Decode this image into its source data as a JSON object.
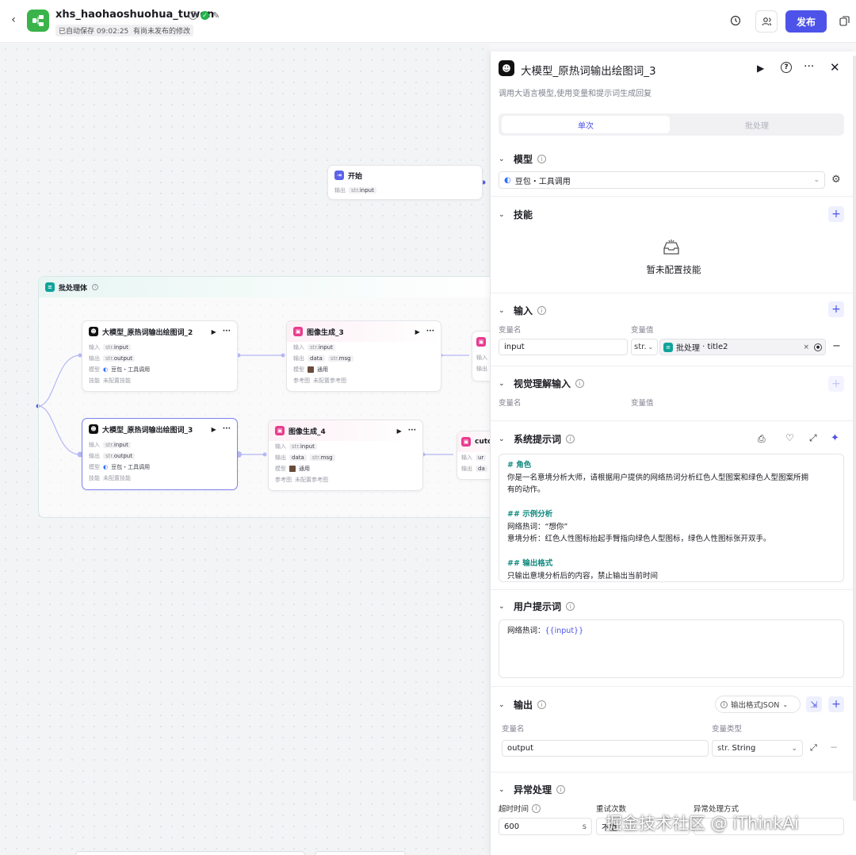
{
  "header": {
    "project_name": "xhs_haohaoshuohua_tuwen",
    "autosave": "已自动保存 09:02:25",
    "unpublished": "有尚未发布的修改",
    "publish_label": "发布"
  },
  "canvas": {
    "start_node": {
      "title": "开始",
      "row_label": "输出",
      "row_type": "str.",
      "row_value": "input"
    },
    "batch_group": {
      "title": "批处理体"
    },
    "nodes": {
      "llm2": {
        "title": "大模型_原热词输出绘图词_2",
        "rows": [
          {
            "label": "输入",
            "type": "str.",
            "value": "input"
          },
          {
            "label": "输出",
            "type": "str.",
            "value": "output"
          },
          {
            "label": "模型",
            "type": "",
            "value": "豆包・工具调用"
          },
          {
            "label": "技能",
            "type": "",
            "value": "未配置技能"
          }
        ]
      },
      "img3": {
        "title": "图像生成_3",
        "rows": [
          {
            "label": "输入",
            "type": "str.",
            "value": "input"
          },
          {
            "label": "输出",
            "type": "",
            "value": "data",
            "extra_type": "str.",
            "extra": "msg"
          },
          {
            "label": "模型",
            "type": "",
            "value": "通用"
          },
          {
            "label": "参考图",
            "type": "",
            "value": "未配置参考图"
          }
        ]
      },
      "llm3": {
        "title": "大模型_原热词输出绘图词_3",
        "rows": [
          {
            "label": "输入",
            "type": "str.",
            "value": "input"
          },
          {
            "label": "输出",
            "type": "str.",
            "value": "output"
          },
          {
            "label": "模型",
            "type": "",
            "value": "豆包・工具调用"
          },
          {
            "label": "技能",
            "type": "",
            "value": "未配置技能"
          }
        ]
      },
      "img4": {
        "title": "图像生成_4",
        "rows": [
          {
            "label": "输入",
            "type": "str.",
            "value": "input"
          },
          {
            "label": "输出",
            "type": "",
            "value": "data",
            "extra_type": "str.",
            "extra": "msg"
          },
          {
            "label": "模型",
            "type": "",
            "value": "通用"
          },
          {
            "label": "参考图",
            "type": "",
            "value": "未配置参考图"
          }
        ]
      },
      "partial_right": {
        "title": "cuto",
        "r1": "输入",
        "r2": "输出",
        "r2v": "ur",
        "r3v": "da"
      }
    }
  },
  "panel": {
    "title": "大模型_原热词输出绘图词_3",
    "description": "调用大语言模型,使用变量和提示词生成回复",
    "tabs": [
      "单次",
      "批处理"
    ],
    "model": {
      "label": "模型",
      "value": "豆包・工具调用"
    },
    "skills": {
      "label": "技能",
      "empty": "暂未配置技能"
    },
    "input": {
      "label": "输入",
      "col_name": "变量名",
      "col_value": "变量值",
      "name": "input",
      "type": "str.",
      "ref_prefix": "批处理",
      "ref_sep": " · ",
      "ref_var": "title2"
    },
    "vision": {
      "label": "视觉理解输入",
      "col_name": "变量名",
      "col_value": "变量值"
    },
    "system_prompt": {
      "label": "系统提示词",
      "lines": [
        {
          "t": "# 角色",
          "h": true
        },
        {
          "t": "你是一名意境分析大师，请根据用户提供的网络热词分析红色人型图案和绿色人型图案所拥",
          "h": false
        },
        {
          "t": "有的动作。",
          "h": false
        },
        {
          "t": "",
          "h": false
        },
        {
          "t": "## 示例分析",
          "h": true
        },
        {
          "t": "网络热词：“想你”",
          "h": false
        },
        {
          "t": "意境分析：红色人性图标抬起手臂指向绿色人型图标，绿色人性图标张开双手。",
          "h": false
        },
        {
          "t": "",
          "h": false
        },
        {
          "t": "## 输出格式",
          "h": true
        },
        {
          "t": "只输出意境分析后的内容，禁止输出当前时间",
          "h": false
        }
      ]
    },
    "user_prompt": {
      "label": "用户提示词",
      "text": "网络热词：",
      "var": "{{input}}"
    },
    "output": {
      "label": "输出",
      "format": "输出格式JSON",
      "col_name": "变量名",
      "col_type": "变量类型",
      "name": "output",
      "type_prefix": "str.",
      "type": "String"
    },
    "exception": {
      "label": "异常处理",
      "timeout_label": "超时时间",
      "timeout_value": "600",
      "timeout_unit": "s",
      "retry_label": "重试次数",
      "retry_value": "不重",
      "method_label": "异常处理方式"
    }
  },
  "watermark": "掘金技术社区 @ iThinkAi",
  "colors": {
    "accent": "#4d53e8",
    "teal": "#0f8a7f",
    "pink": "#e93b8e",
    "brand_green": "#3ab34a"
  }
}
